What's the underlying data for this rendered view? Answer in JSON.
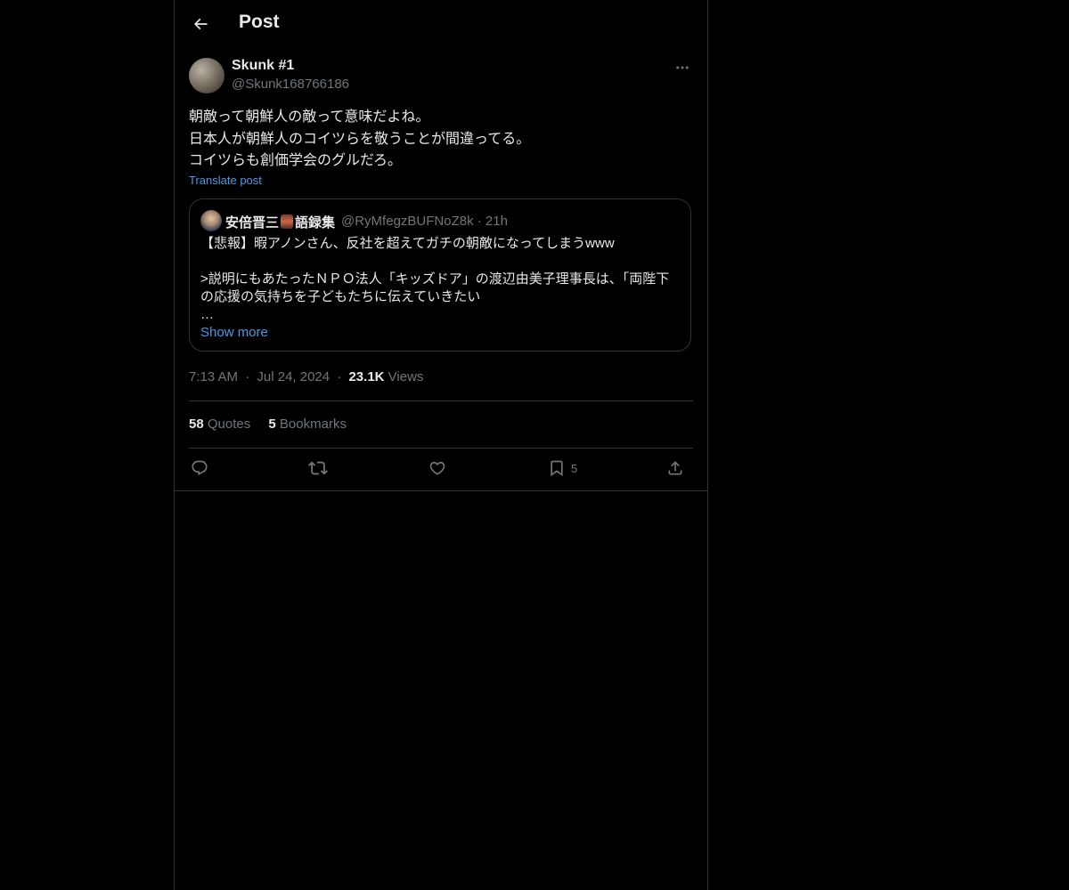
{
  "header": {
    "title": "Post",
    "back_icon": "arrow-left-icon"
  },
  "post": {
    "author": {
      "display_name": "Skunk #1",
      "handle": "@Skunk168766186"
    },
    "text": "朝敵って朝鮮人の敵って意味だよね。\n日本人が朝鮮人のコイツらを敬うことが間違ってる。\nコイツらも創価学会のグルだろ。",
    "translate_label": "Translate post",
    "quote": {
      "name_part1": "安倍晋三",
      "name_part2": "語録集",
      "handle_time": "@RyMfegzBUFNoZ8k · 21h",
      "body": "【悲報】暇アノンさん、反社を超えてガチの朝敵になってしまうwww\n\n>説明にもあたったＮＰＯ法人「キッズドア」の渡辺由美子理事長は、「両陛下の応援の気持ちを子どもたちに伝えていきたい\n…",
      "show_more": "Show more"
    },
    "time": "7:13 AM",
    "date": "Jul 24, 2024",
    "views_count": "23.1K",
    "views_label": "Views",
    "dot": "·"
  },
  "stats": {
    "quotes_count": "58",
    "quotes_label": "Quotes",
    "bookmarks_count": "5",
    "bookmarks_label": "Bookmarks"
  },
  "actions": {
    "reply_icon": "reply-icon",
    "repost_icon": "repost-icon",
    "like_icon": "like-icon",
    "bookmark_icon": "bookmark-icon",
    "bookmark_count": "5",
    "share_icon": "share-icon"
  },
  "colors": {
    "background": "#000000",
    "text": "#e7e9ea",
    "muted": "#71767b",
    "link": "#4b9ae3",
    "border": "#2f3336"
  }
}
